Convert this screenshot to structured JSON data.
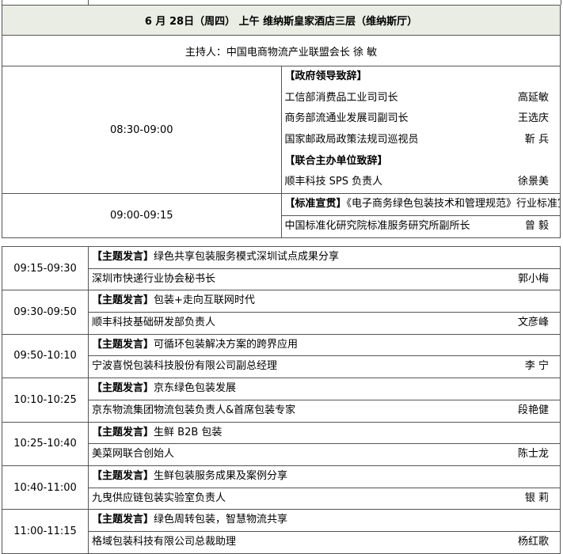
{
  "header": {
    "date_line": "6 月 28日（周四） 上午  维纳斯皇家酒店三层（维纳斯厅）",
    "host_line": "主持人：中国电商物流产业联盟会长    徐    敏"
  },
  "block1": [
    {
      "time": "08:30-09:00",
      "lines": [
        {
          "text": "【政府领导致辞】",
          "person": "",
          "bold": true
        },
        {
          "text": "工信部消费品工业司司长",
          "person": "高延敏",
          "bold": false
        },
        {
          "text": "商务部流通业发展司副司长",
          "person": "王选庆",
          "bold": false
        },
        {
          "text": "国家邮政局政策法规司巡视员",
          "person": "靳    兵",
          "bold": false
        },
        {
          "text": "【联合主办单位致辞】",
          "person": "",
          "bold": true
        },
        {
          "text": "顺丰科技 SPS 负责人",
          "person": "徐景美",
          "bold": false
        }
      ]
    },
    {
      "time": "09:00-09:15",
      "lines": [
        {
          "label": "【标准宣贯】",
          "text": "《电子商务绿色包装技术和管理规范》行业标准宣贯&绿色包装认定细则发布",
          "person": ""
        },
        {
          "text": "中国标准化研究院标准服务研究所副所长",
          "person": "曾    毅"
        }
      ]
    }
  ],
  "block2": [
    {
      "time": "09:15-09:30",
      "label": "【主题发言】",
      "topic": "绿色共享包装服务模式深圳试点成果分享",
      "speaker_org": "深圳市快递行业协会秘书长",
      "person": "郭小梅"
    },
    {
      "time": "09:30-09:50",
      "label": "【主题发言】",
      "topic": "包装+走向互联网时代",
      "speaker_org": "顺丰科技基础研发部负责人",
      "person": "文彦峰"
    },
    {
      "time": "09:50-10:10",
      "label": "【主题发言】",
      "topic": "可循环包装解决方案的跨界应用",
      "speaker_org": "宁波喜悦包装科技股份有限公司副总经理",
      "person": "李    宁"
    },
    {
      "time": "10:10-10:25",
      "label": "【主题发言】",
      "topic": "京东绿色包装发展",
      "speaker_org": "京东物流集团物流包装负责人&首席包装专家",
      "person": "段艳健"
    },
    {
      "time": "10:25-10:40",
      "label": "【主题发言】",
      "topic": "生鲜 B2B 包装",
      "speaker_org": "美菜网联合创始人",
      "person": "陈士龙"
    },
    {
      "time": "10:40-11:00",
      "label": "【主题发言】",
      "topic": "生鲜包装服务成果及案例分享",
      "speaker_org": "九曳供应链包装实验室负责人",
      "person": "银    莉"
    },
    {
      "time": "11:00-11:15",
      "label": "【主题发言】",
      "topic": "绿色周转包装，智慧物流共享",
      "speaker_org": "格域包装科技有限公司总裁助理",
      "person": "杨红歌"
    }
  ]
}
